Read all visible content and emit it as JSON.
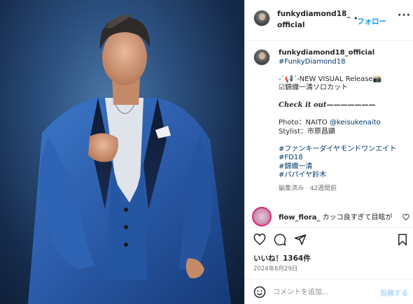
{
  "post": {
    "username": "funkydiamond18_official",
    "follow_label": "フォロー",
    "separator": "•",
    "more_label": "···",
    "photo_alt": "Man in blue suit portrait"
  },
  "caption": {
    "username": "funkydiamond18_official",
    "lines": [
      {
        "text": "#FunkyDiamond18",
        "type": "tag"
      },
      {
        "text": "",
        "type": "gap"
      },
      {
        "text": "-`📢´-NEW VISUAL Release📸",
        "type": "text"
      },
      {
        "text": "☑錦織一清ソロカット",
        "type": "text"
      },
      {
        "text": "",
        "type": "gap"
      },
      {
        "text": "Check it out———————",
        "type": "checkit"
      },
      {
        "text": "",
        "type": "gap"
      },
      {
        "text": "Photo：NAITO ",
        "type": "text",
        "tag": "@keisukenaito"
      },
      {
        "text": "Stylist：市原昌顕",
        "type": "text"
      },
      {
        "text": "",
        "type": "gap"
      },
      {
        "text": "#ファンキーダイヤモンドワンエイト",
        "type": "tag"
      },
      {
        "text": "#FD18",
        "type": "tag"
      },
      {
        "text": "#錦織一清",
        "type": "tag"
      },
      {
        "text": "#パパイヤ鈴木",
        "type": "tag"
      }
    ],
    "meta": "編集済み · 42週間前"
  },
  "comment": {
    "username": "flow_flora_",
    "text": "カッコ良すぎて目眩が"
  },
  "actions": {
    "like_icon": "heart-icon",
    "comment_icon": "comment-icon",
    "share_icon": "share-icon",
    "save_icon": "bookmark-icon"
  },
  "likes_text": "いいね！1364件",
  "date_text": "2024年6月29日",
  "add_comment": {
    "placeholder": "コメントを追加...",
    "post_label": "投稿する"
  },
  "colors": {
    "link": "#0095f6",
    "tag": "#00376b",
    "muted": "#737373",
    "suit_blue": "#2a5aa8",
    "background_blue": "#1f3d66"
  }
}
